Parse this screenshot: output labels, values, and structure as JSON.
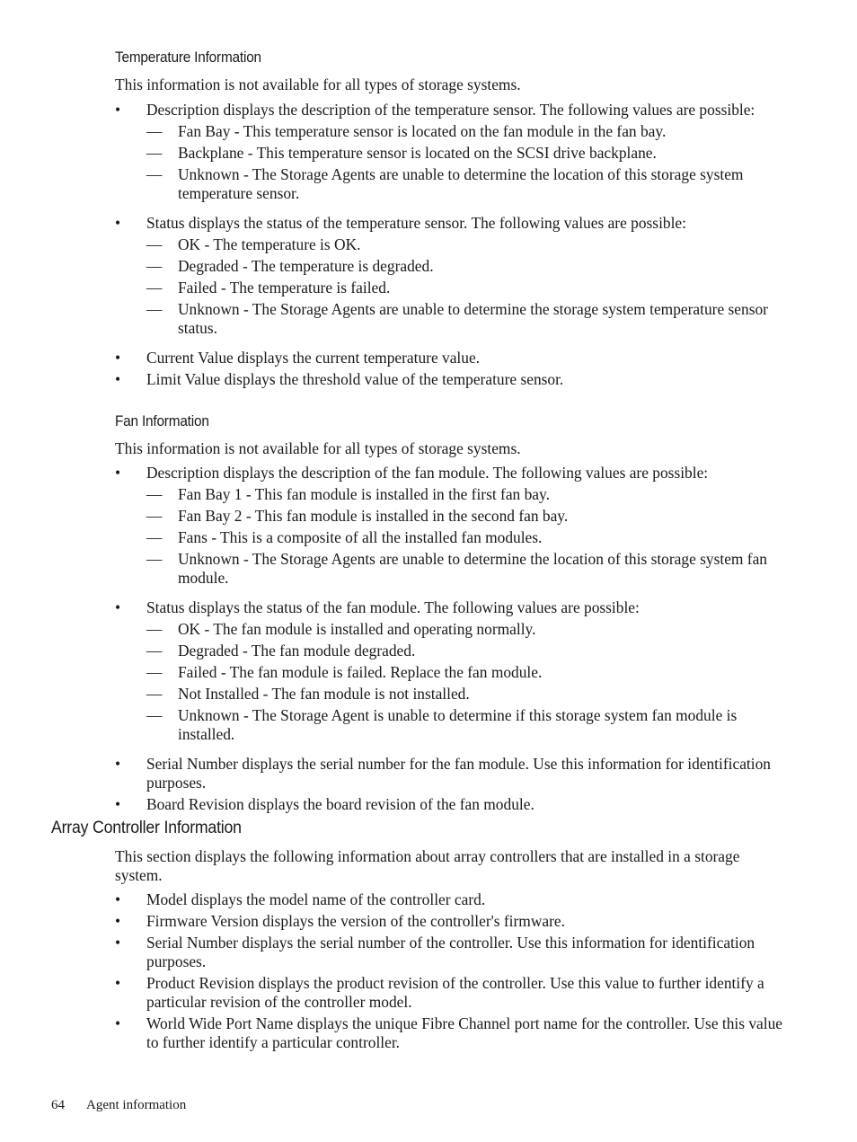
{
  "temperature": {
    "heading": "Temperature Information",
    "intro": "This information is not available for all types of storage systems.",
    "items": [
      {
        "text": "Description displays the description of the temperature sensor. The following values are possible:",
        "sub": [
          "Fan Bay - This temperature sensor is located on the fan module in the fan bay.",
          "Backplane - This temperature sensor is located on the SCSI drive backplane.",
          "Unknown - The Storage Agents are unable to determine the location of this storage system temperature sensor."
        ]
      },
      {
        "text": "Status displays the status of the temperature sensor. The following values are possible:",
        "sub": [
          "OK - The temperature is OK.",
          "Degraded - The temperature is degraded.",
          "Failed - The temperature is failed.",
          "Unknown - The Storage Agents are unable to determine the storage system temperature sensor status."
        ]
      },
      {
        "text": "Current Value displays the current temperature value.",
        "sub": []
      },
      {
        "text": "Limit Value displays the threshold value of the temperature sensor.",
        "sub": []
      }
    ]
  },
  "fan": {
    "heading": "Fan Information",
    "intro": "This information is not available for all types of storage systems.",
    "items": [
      {
        "text": "Description displays the description of the fan module. The following values are possible:",
        "sub": [
          "Fan Bay 1 - This fan module is installed in the first fan bay.",
          "Fan Bay 2 - This fan module is installed in the second fan bay.",
          "Fans - This is a composite of all the installed fan modules.",
          "Unknown - The Storage Agents are unable to determine the location of this storage system fan module."
        ]
      },
      {
        "text": "Status displays the status of the fan module. The following values are possible:",
        "sub": [
          "OK - The fan module is installed and operating normally.",
          "Degraded - The fan module degraded.",
          "Failed - The fan module is failed. Replace the fan module.",
          "Not Installed - The fan module is not installed.",
          "Unknown - The Storage Agent is unable to determine if this storage system fan module is installed."
        ]
      },
      {
        "text": "Serial Number displays the serial number for the fan module. Use this information for identification purposes.",
        "sub": []
      },
      {
        "text": "Board Revision displays the board revision of the fan module.",
        "sub": []
      }
    ]
  },
  "array": {
    "heading": "Array Controller Information",
    "intro": "This section displays the following information about array controllers that are installed in a storage system.",
    "items": [
      {
        "text": "Model displays the model name of the controller card.",
        "sub": []
      },
      {
        "text": "Firmware Version displays the version of the controller's firmware.",
        "sub": []
      },
      {
        "text": "Serial Number displays the serial number of the controller. Use this information for identification purposes.",
        "sub": []
      },
      {
        "text": "Product Revision displays the product revision of the controller. Use this value to further identify a particular revision of the controller model.",
        "sub": []
      },
      {
        "text": "World Wide Port Name displays the unique Fibre Channel port name for the controller. Use this value to further identify a particular controller.",
        "sub": []
      }
    ]
  },
  "glyphs": {
    "bullet": "•",
    "dash": "—"
  },
  "footer": {
    "page_number": "64",
    "section": "Agent information"
  }
}
